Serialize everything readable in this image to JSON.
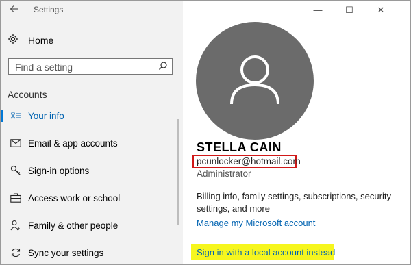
{
  "window": {
    "title": "Settings",
    "controls": {
      "minimize": "—",
      "maximize": "☐",
      "close": "✕"
    }
  },
  "sidebar": {
    "home_label": "Home",
    "search_placeholder": "Find a setting",
    "section_title": "Accounts",
    "items": [
      {
        "label": "Your info",
        "icon": "person-card-icon",
        "active": true
      },
      {
        "label": "Email & app accounts",
        "icon": "mail-icon",
        "active": false
      },
      {
        "label": "Sign-in options",
        "icon": "key-icon",
        "active": false
      },
      {
        "label": "Access work or school",
        "icon": "briefcase-icon",
        "active": false
      },
      {
        "label": "Family & other people",
        "icon": "people-icon",
        "active": false
      },
      {
        "label": "Sync your settings",
        "icon": "sync-icon",
        "active": false
      }
    ]
  },
  "profile": {
    "name": "STELLA CAIN",
    "email": "pcunlocker@hotmail.com",
    "role": "Administrator",
    "billing_text": "Billing info, family settings, subscriptions, security settings, and more",
    "manage_link": "Manage my Microsoft account",
    "signin_link": "Sign in with a local account instead"
  },
  "colors": {
    "accent": "#0078d7",
    "link": "#0063b1",
    "highlight_red": "#d01818",
    "highlight_yellow": "#f6f61e",
    "avatar_bg": "#6b6b6b"
  }
}
